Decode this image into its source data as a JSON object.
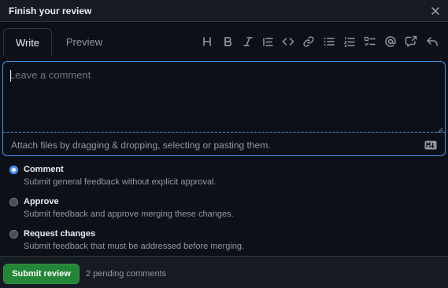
{
  "header": {
    "title": "Finish your review"
  },
  "tabs": [
    {
      "label": "Write"
    },
    {
      "label": "Preview"
    }
  ],
  "toolbar": {
    "icons": [
      "heading-icon",
      "bold-icon",
      "italic-icon",
      "quote-icon",
      "code-icon",
      "link-icon",
      "unordered-list-icon",
      "ordered-list-icon",
      "task-list-icon",
      "mention-icon",
      "reference-icon",
      "reply-icon"
    ]
  },
  "editor": {
    "placeholder": "Leave a comment",
    "value": "",
    "attach_text": "Attach files by dragging & dropping, selecting or pasting them."
  },
  "options": [
    {
      "label": "Comment",
      "description": "Submit general feedback without explicit approval.",
      "selected": true
    },
    {
      "label": "Approve",
      "description": "Submit feedback and approve merging these changes.",
      "selected": false
    },
    {
      "label": "Request changes",
      "description": "Submit feedback that must be addressed before merging.",
      "selected": false
    }
  ],
  "footer": {
    "submit_label": "Submit review",
    "pending_text": "2 pending comments"
  },
  "colors": {
    "accent": "#4493f8",
    "submit": "#238636",
    "background": "#0d1117",
    "header_bg": "#161b22"
  }
}
